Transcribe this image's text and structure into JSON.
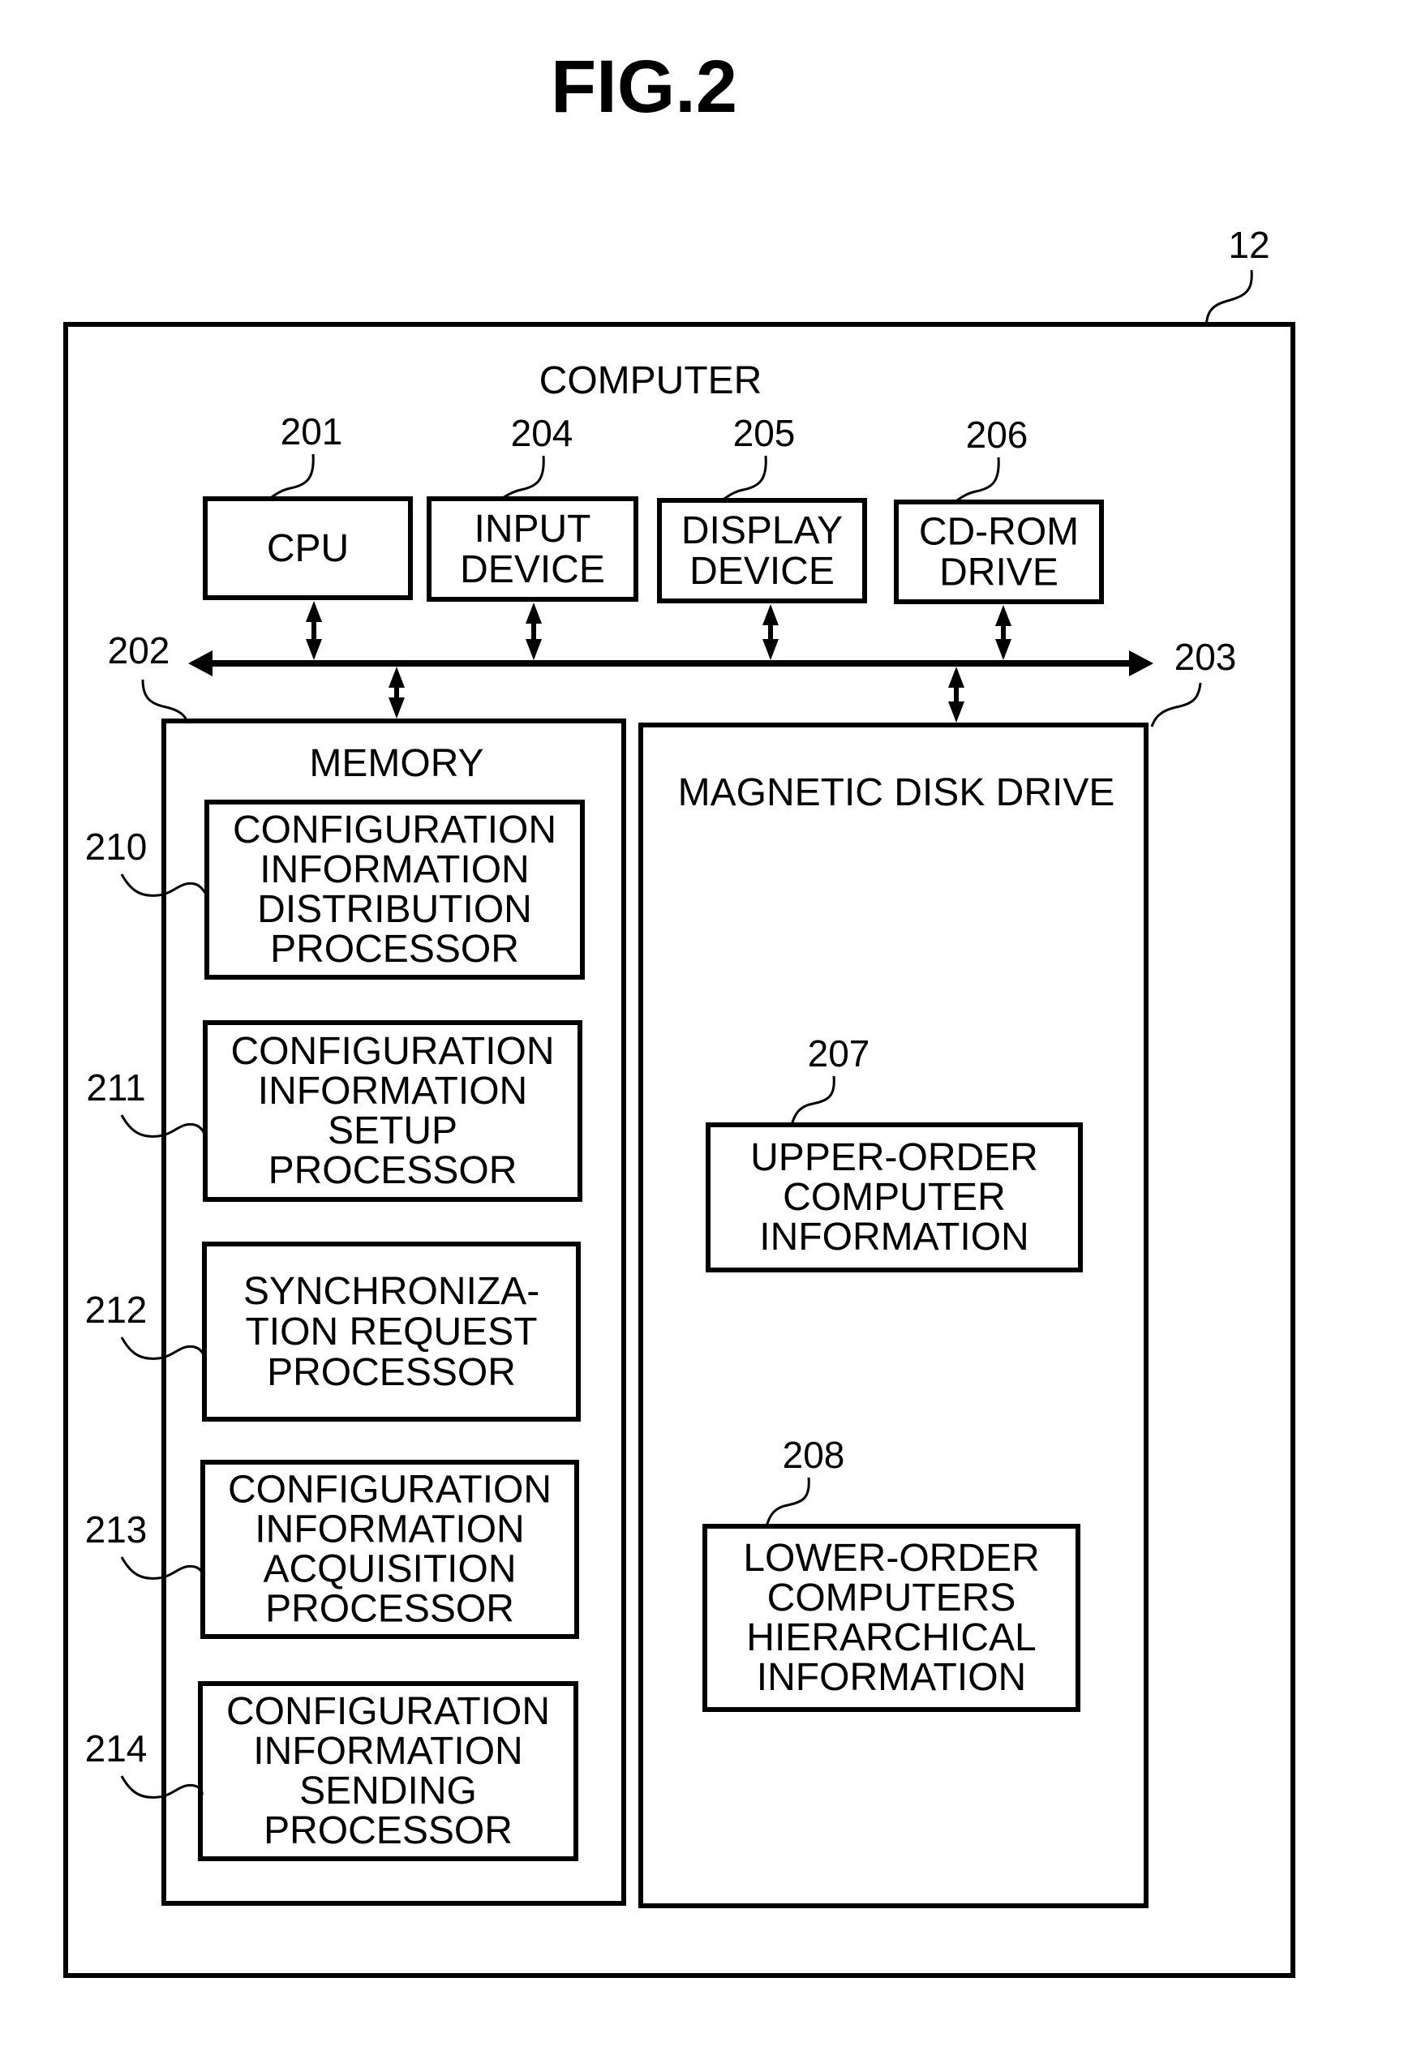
{
  "figure": {
    "title": "FIG.2",
    "ref": "12",
    "label": "COMPUTER"
  },
  "bus": {
    "left_ref": "202",
    "right_ref": "203"
  },
  "devices": [
    {
      "id": "cpu",
      "ref": "201",
      "lines": [
        "CPU"
      ]
    },
    {
      "id": "input-device",
      "ref": "204",
      "lines": [
        "INPUT",
        "DEVICE"
      ]
    },
    {
      "id": "display-device",
      "ref": "205",
      "lines": [
        "DISPLAY",
        "DEVICE"
      ]
    },
    {
      "id": "cd-rom-drive",
      "ref": "206",
      "lines": [
        "CD-ROM",
        "DRIVE"
      ]
    }
  ],
  "memory": {
    "label": "MEMORY",
    "processors": [
      {
        "id": "config-info-distribution-processor",
        "ref": "210",
        "lines": [
          "CONFIGURATION",
          "INFORMATION",
          "DISTRIBUTION",
          "PROCESSOR"
        ]
      },
      {
        "id": "config-info-setup-processor",
        "ref": "211",
        "lines": [
          "CONFIGURATION",
          "INFORMATION",
          "SETUP",
          "PROCESSOR"
        ]
      },
      {
        "id": "sync-request-processor",
        "ref": "212",
        "lines": [
          "SYNCHRONIZA-",
          "TION REQUEST",
          "PROCESSOR"
        ]
      },
      {
        "id": "config-info-acquisition-processor",
        "ref": "213",
        "lines": [
          "CONFIGURATION",
          "INFORMATION",
          "ACQUISITION",
          "PROCESSOR"
        ]
      },
      {
        "id": "config-info-sending-processor",
        "ref": "214",
        "lines": [
          "CONFIGURATION",
          "INFORMATION",
          "SENDING",
          "PROCESSOR"
        ]
      }
    ]
  },
  "disk": {
    "label": "MAGNETIC DISK DRIVE",
    "items": [
      {
        "id": "upper-order-computer-info",
        "ref": "207",
        "lines": [
          "UPPER-ORDER",
          "COMPUTER",
          "INFORMATION"
        ]
      },
      {
        "id": "lower-order-computers-hierarchical-info",
        "ref": "208",
        "lines": [
          "LOWER-ORDER",
          "COMPUTERS",
          "HIERARCHICAL",
          "INFORMATION"
        ]
      }
    ]
  }
}
